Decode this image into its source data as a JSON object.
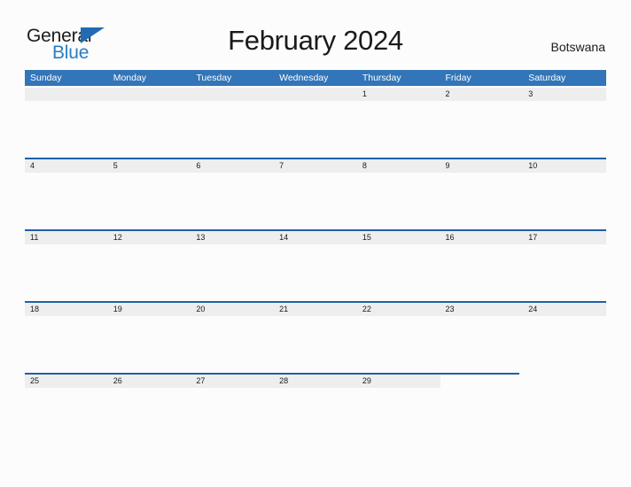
{
  "brand": {
    "name_part1": "General",
    "name_part2": "Blue",
    "triangle_color": "#1f6cb4",
    "text_color": "#1b1b1b",
    "blue_color": "#2a7ec4"
  },
  "header": {
    "title": "February 2024",
    "locale": "Botswana"
  },
  "colors": {
    "header_blue": "#3275b8",
    "rule_blue": "#1f5fa8",
    "date_band_gray": "#eeeeee",
    "page_background": "#fcfcfc",
    "text_dark": "#1a1a1a",
    "text_white": "#ffffff"
  },
  "calendar": {
    "month": "February",
    "year": "2024",
    "weekday_headers": [
      "Sunday",
      "Monday",
      "Tuesday",
      "Wednesday",
      "Thursday",
      "Friday",
      "Saturday"
    ],
    "weeks": [
      [
        "",
        "",
        "",
        "",
        "1",
        "2",
        "3"
      ],
      [
        "4",
        "5",
        "6",
        "7",
        "8",
        "9",
        "10"
      ],
      [
        "11",
        "12",
        "13",
        "14",
        "15",
        "16",
        "17"
      ],
      [
        "18",
        "19",
        "20",
        "21",
        "22",
        "23",
        "24"
      ],
      [
        "25",
        "26",
        "27",
        "28",
        "29",
        "",
        ""
      ]
    ]
  }
}
